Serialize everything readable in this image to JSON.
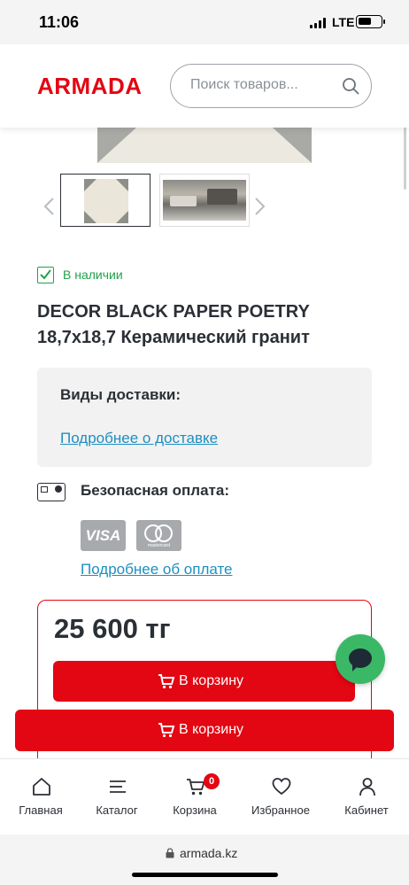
{
  "status_bar": {
    "time": "11:06",
    "network": "LTE"
  },
  "header": {
    "logo": "ARMADA",
    "search_placeholder": "Поиск товаров..."
  },
  "product": {
    "stock_status": "В наличии",
    "title": "DECOR BLACK PAPER POETRY 18,7x18,7 Керамический гранит"
  },
  "delivery": {
    "title": "Виды доставки:",
    "link": "Подробнее о доставке"
  },
  "payment": {
    "title": "Безопасная оплата:",
    "visa": "VISA",
    "mastercard": "mastercard",
    "link": "Подробнее об оплате"
  },
  "price": {
    "value": "25 600 тг",
    "add_to_cart": "В корзину",
    "sticky_add_to_cart": "В корзину"
  },
  "bottom_nav": {
    "home": "Главная",
    "catalog": "Каталог",
    "cart": "Корзина",
    "cart_count": "0",
    "favorites": "Избранное",
    "account": "Кабинет"
  },
  "browser": {
    "url": "armada.kz"
  },
  "colors": {
    "brand": "#e30613",
    "link": "#1e8fc0",
    "in_stock": "#1fa24a",
    "chat": "#3bb866"
  }
}
